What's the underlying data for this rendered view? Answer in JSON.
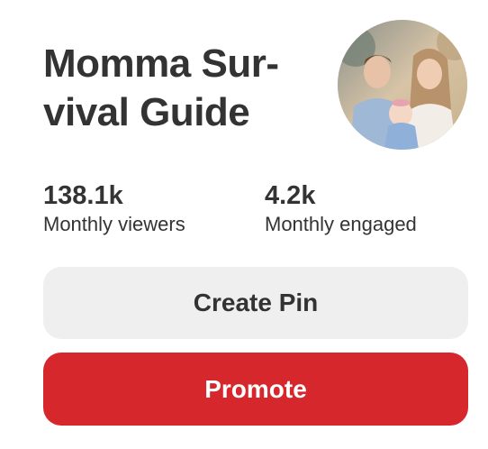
{
  "profile": {
    "title_line1": "Momma Sur-",
    "title_line2": "vival Guide",
    "avatar_icon": "family-photo-avatar"
  },
  "stats": [
    {
      "value": "138.1k",
      "label": "Monthly viewers"
    },
    {
      "value": "4.2k",
      "label": "Monthly engaged"
    }
  ],
  "actions": {
    "create_label": "Create Pin",
    "promote_label": "Promote"
  },
  "colors": {
    "promote_bg": "#d5272c",
    "create_bg": "#efefef",
    "text": "#333333"
  }
}
